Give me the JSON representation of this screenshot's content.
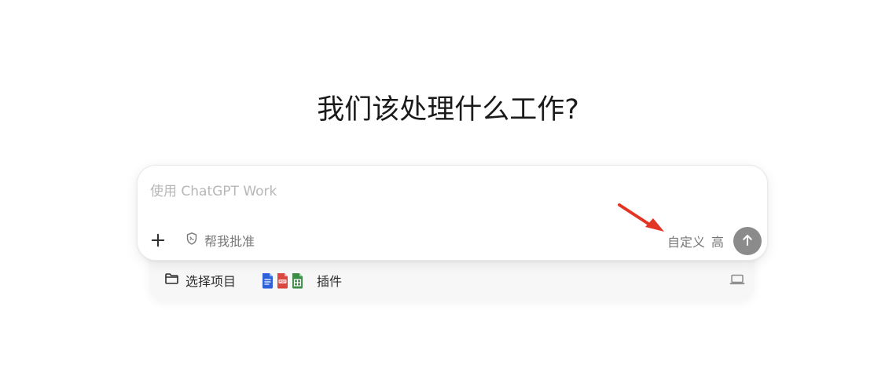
{
  "heading": "我们该处理什么工作?",
  "composer": {
    "input_value": "",
    "placeholder": "使用 ChatGPT Work",
    "plus_icon": "plus-icon",
    "approval_label": "帮我批准",
    "approval_icon": "shield-code-icon",
    "custom_label": "自定义",
    "level_label": "高",
    "send_icon": "arrow-up-icon"
  },
  "tray": {
    "project_label": "选择项目",
    "project_icon": "folder-icon",
    "plugins_label": "插件",
    "plugin_icons": [
      "document-icon",
      "pdf-icon",
      "spreadsheet-icon"
    ],
    "device_icon": "laptop-icon"
  },
  "annotation": {
    "arrow_icon": "red-arrow-icon",
    "arrow_color": "#e33524"
  },
  "colors": {
    "background": "#ffffff",
    "send_button": "#8b8b8b",
    "muted_text": "#777777",
    "tray_background": "#f7f7f7"
  }
}
